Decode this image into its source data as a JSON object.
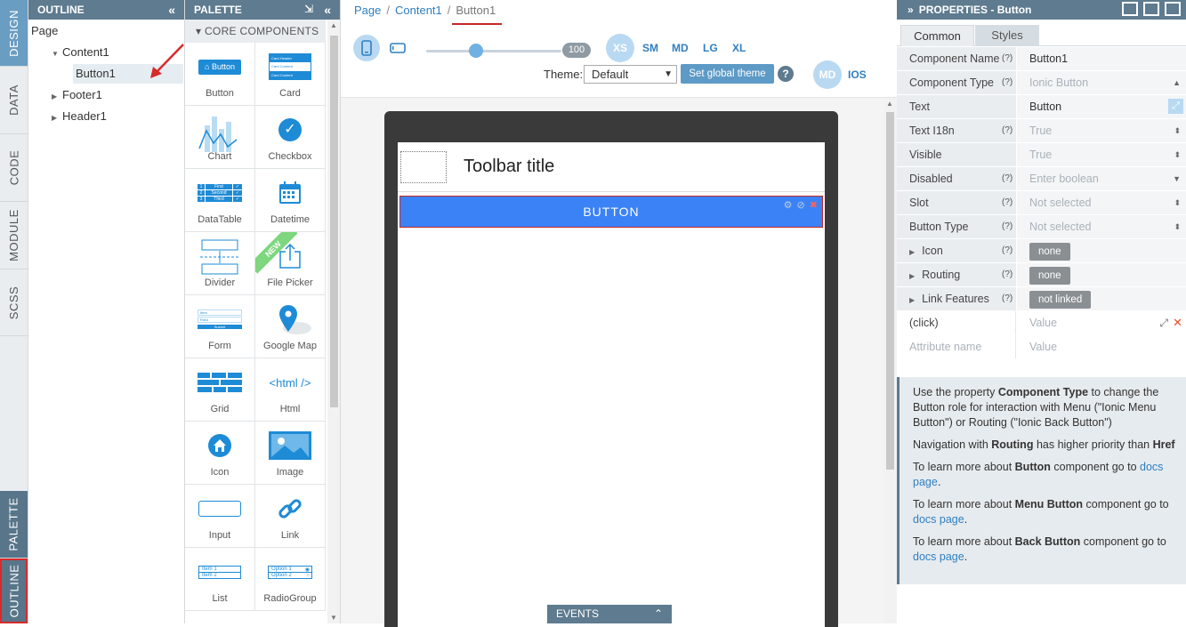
{
  "vtabs": {
    "design": "DESIGN",
    "data": "DATA",
    "code": "CODE",
    "module": "MODULE",
    "scss": "SCSS",
    "palette": "PALETTE",
    "outline": "OUTLINE"
  },
  "outline": {
    "title": "OUTLINE",
    "tree": [
      {
        "label": "Page"
      },
      {
        "label": "Content1"
      },
      {
        "label": "Button1"
      },
      {
        "label": "Footer1"
      },
      {
        "label": "Header1"
      }
    ]
  },
  "palette": {
    "title": "PALETTE",
    "section": "CORE COMPONENTS",
    "items": [
      {
        "label": "Button",
        "icon": "button-icon"
      },
      {
        "label": "Card",
        "icon": "card-icon"
      },
      {
        "label": "Chart",
        "icon": "chart-icon"
      },
      {
        "label": "Checkbox",
        "icon": "checkbox-icon"
      },
      {
        "label": "DataTable",
        "icon": "datatable-icon"
      },
      {
        "label": "Datetime",
        "icon": "calendar-icon"
      },
      {
        "label": "Divider",
        "icon": "divider-icon"
      },
      {
        "label": "File Picker",
        "icon": "upload-icon"
      },
      {
        "label": "Form",
        "icon": "form-icon"
      },
      {
        "label": "Google Map",
        "icon": "map-pin-icon"
      },
      {
        "label": "Grid",
        "icon": "grid-icon"
      },
      {
        "label": "Html",
        "icon": "html-icon"
      },
      {
        "label": "Icon",
        "icon": "home-icon"
      },
      {
        "label": "Image",
        "icon": "image-icon"
      },
      {
        "label": "Input",
        "icon": "input-icon"
      },
      {
        "label": "Link",
        "icon": "link-icon"
      },
      {
        "label": "List",
        "icon": "list-icon"
      },
      {
        "label": "RadioGroup",
        "icon": "radio-icon"
      }
    ],
    "button_mini_text": "Button",
    "card_mini": [
      "Card Header",
      "Card Content",
      "Card Content"
    ],
    "new_badge": "NEW",
    "html_glyph": "<html />",
    "datatable_mini": [
      "1",
      "First",
      "2",
      "Second",
      "3",
      "Third"
    ],
    "form_mini": [
      "Item",
      "Field",
      "Submit"
    ],
    "list_mini": [
      "Item 1",
      "Item 2"
    ],
    "radio_mini": [
      "Option 1",
      "Option 2"
    ]
  },
  "breadcrumb": {
    "items": [
      "Page",
      "Content1"
    ],
    "current": "Button1",
    "separator": "/"
  },
  "toolbar": {
    "zoom": "100",
    "zoom_fraction": 0.37,
    "sizes": [
      "XS",
      "SM",
      "MD",
      "LG",
      "XL"
    ],
    "theme_label": "Theme:",
    "theme_value": "Default",
    "global_theme_button": "Set global theme",
    "help": "?",
    "mode_md": "MD",
    "mode_ios": "IOS"
  },
  "canvas": {
    "toolbar_title": "Toolbar title",
    "button_text": "BUTTON",
    "events_label": "EVENTS"
  },
  "properties": {
    "title": "PROPERTIES - Button",
    "tabs": [
      "Common",
      "Styles"
    ],
    "rows": [
      {
        "name": "Component Name",
        "help": "(?)",
        "value": "Button1",
        "placeholder": false
      },
      {
        "name": "Component Type",
        "help": "(?)",
        "value": "Ionic Button",
        "placeholder": true
      },
      {
        "name": "Text",
        "help": "",
        "value": "Button",
        "placeholder": false
      },
      {
        "name": "Text I18n",
        "help": "(?)",
        "value": "True",
        "placeholder": true
      },
      {
        "name": "Visible",
        "help": "",
        "value": "True",
        "placeholder": true
      },
      {
        "name": "Disabled",
        "help": "(?)",
        "value": "Enter boolean",
        "placeholder": true
      },
      {
        "name": "Slot",
        "help": "(?)",
        "value": "Not selected",
        "placeholder": true
      },
      {
        "name": "Button Type",
        "help": "(?)",
        "value": "Not selected",
        "placeholder": true
      },
      {
        "name": "Icon",
        "help": "(?)",
        "value": "none",
        "pill": true
      },
      {
        "name": "Routing",
        "help": "(?)",
        "value": "none",
        "pill": true
      },
      {
        "name": "Link Features",
        "help": "(?)",
        "value": "not linked",
        "pill": true
      },
      {
        "name": "(click)",
        "help": "",
        "value": "Value",
        "placeholder": true
      },
      {
        "name": "Attribute name",
        "help": "",
        "value": "Value",
        "placeholder": true
      }
    ],
    "info": {
      "p1_a": "Use the property ",
      "p1_b": "Component Type",
      "p1_c": " to change the Button role for interaction with Menu (\"Ionic Menu Button\") or Routing (\"Ionic Back Button\")",
      "p2_a": "Navigation with ",
      "p2_b": "Routing",
      "p2_c": " has higher priority than ",
      "p2_d": "Href",
      "p3_a": "To learn more about ",
      "p3_b": "Button",
      "p3_c": " component go to ",
      "p3_link": "docs page",
      "p3_d": ".",
      "p4_a": "To learn more about ",
      "p4_b": "Menu Button",
      "p4_c": " component go to ",
      "p4_link": "docs page",
      "p4_d": ".",
      "p5_a": "To learn more about ",
      "p5_b": "Back Button",
      "p5_c": " component go to ",
      "p5_link": "docs page",
      "p5_d": "."
    }
  },
  "colors": {
    "panel_header": "#5e7b8f",
    "accent_blue": "#2f7fc1",
    "ion_button": "#3b82f6",
    "annotation_red": "#c62828"
  }
}
